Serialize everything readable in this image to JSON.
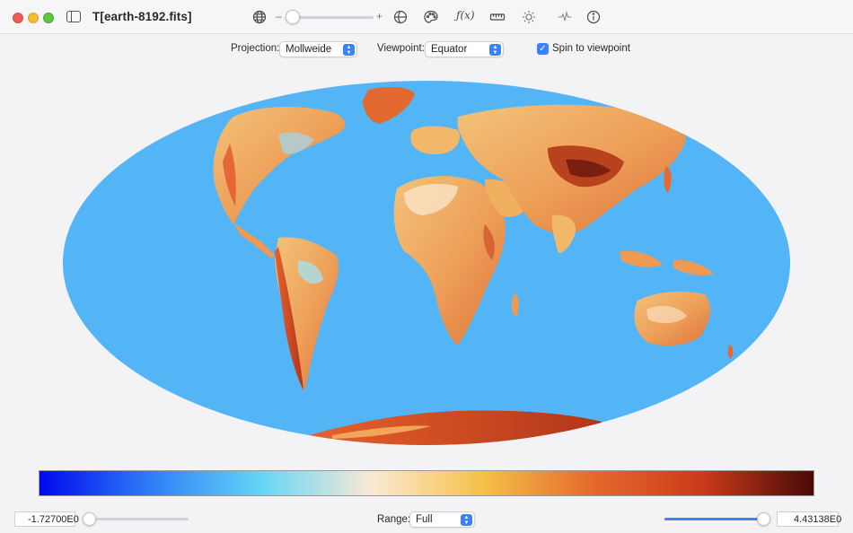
{
  "window": {
    "title": "T[earth-8192.fits]"
  },
  "toolbar": {
    "zoom_minus": "–",
    "zoom_plus": "+",
    "zoom_level": 0,
    "fx_label": "ƒ(x)",
    "icons": [
      "sidebar-icon",
      "globe-icon",
      "grid-globe-icon",
      "palette-icon",
      "function-icon",
      "ruler-icon",
      "brightness-icon",
      "waveform-icon",
      "info-icon"
    ]
  },
  "options": {
    "projection_label": "Projection:",
    "projection_value": "Mollweide",
    "viewpoint_label": "Viewpoint:",
    "viewpoint_value": "Equator",
    "spin_label": "Spin to viewpoint",
    "spin_checked": true
  },
  "map": {
    "projection": "Mollweide",
    "ocean_color": "#53b5f5"
  },
  "colorbar": {
    "stops": [
      "#0009ee",
      "#2f7df7",
      "#63d6f6",
      "#fbe9d6",
      "#f6c14a",
      "#e66a2c",
      "#c93a1a",
      "#4a0a06"
    ]
  },
  "bottom": {
    "min_value": "-1.72700E0",
    "max_value": "4.43138E0",
    "range_label": "Range:",
    "range_value": "Full",
    "min_slider": 0,
    "max_slider": 1
  }
}
